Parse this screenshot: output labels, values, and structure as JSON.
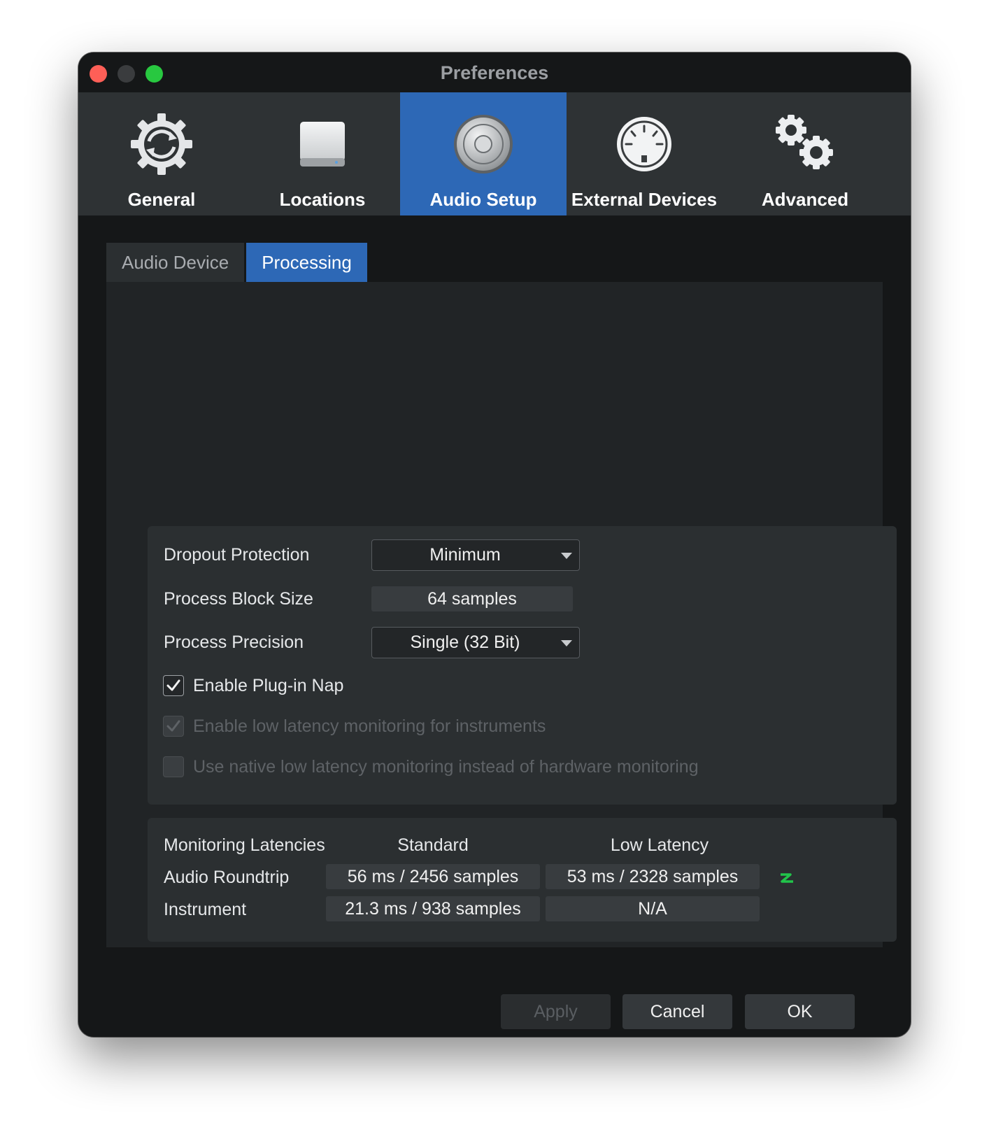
{
  "window": {
    "title": "Preferences"
  },
  "toolbar": {
    "items": [
      {
        "label": "General",
        "icon": "gear-sync-icon",
        "active": false
      },
      {
        "label": "Locations",
        "icon": "hard-drive-icon",
        "active": false
      },
      {
        "label": "Audio Setup",
        "icon": "speaker-icon",
        "active": true
      },
      {
        "label": "External Devices",
        "icon": "midi-connector-icon",
        "active": false
      },
      {
        "label": "Advanced",
        "icon": "gears-icon",
        "active": false
      }
    ]
  },
  "tabs": [
    {
      "label": "Audio Device",
      "active": false
    },
    {
      "label": "Processing",
      "active": true
    }
  ],
  "processing": {
    "dropout_protection": {
      "label": "Dropout Protection",
      "value": "Minimum"
    },
    "process_block_size": {
      "label": "Process Block Size",
      "value": "64 samples"
    },
    "process_precision": {
      "label": "Process Precision",
      "value": "Single (32 Bit)"
    },
    "enable_plugin_nap": {
      "label": "Enable Plug-in Nap",
      "checked": true,
      "enabled": true
    },
    "low_latency_instruments": {
      "label": "Enable low latency monitoring for instruments",
      "checked": true,
      "enabled": false
    },
    "native_low_latency": {
      "label": "Use native low latency monitoring instead of hardware monitoring",
      "checked": false,
      "enabled": false
    }
  },
  "latencies": {
    "title": "Monitoring Latencies",
    "col_standard": "Standard",
    "col_low": "Low Latency",
    "rows": [
      {
        "label": "Audio Roundtrip",
        "standard": "56 ms / 2456 samples",
        "low": "53 ms / 2328 samples"
      },
      {
        "label": "Instrument",
        "standard": "21.3 ms / 938 samples",
        "low": "N/A"
      }
    ],
    "indicator_color": "#21c44a"
  },
  "buttons": {
    "apply": "Apply",
    "cancel": "Cancel",
    "ok": "OK"
  },
  "colors": {
    "accent": "#2d68b6",
    "window_bg": "#151718",
    "panel_bg": "#2b2f31"
  }
}
